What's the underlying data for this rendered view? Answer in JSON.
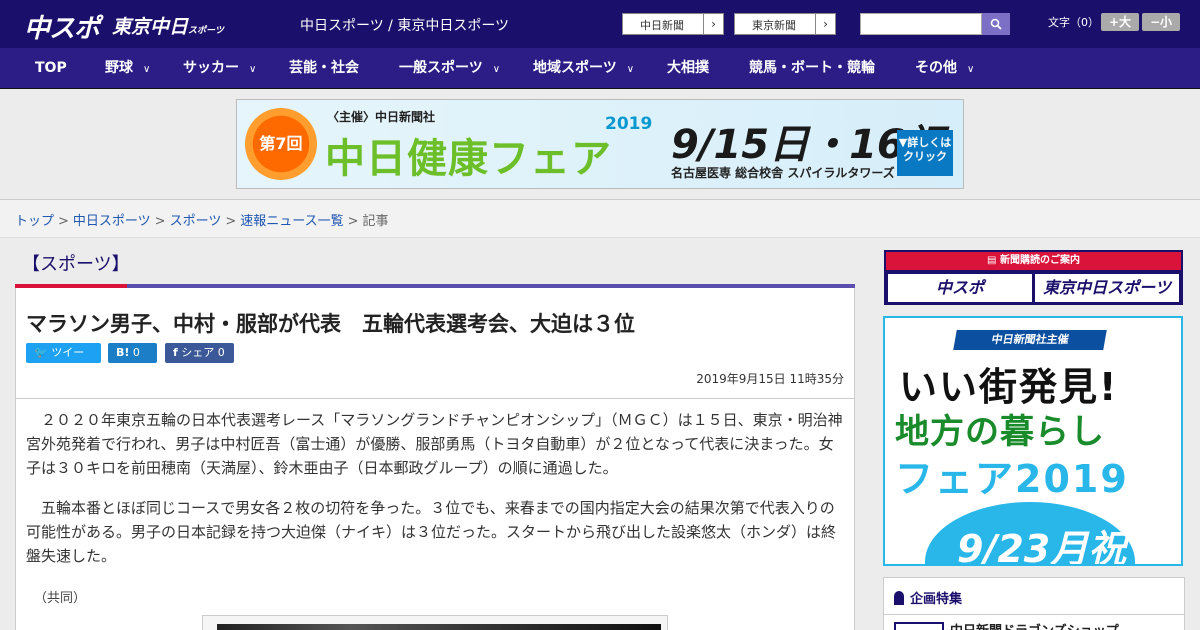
{
  "header": {
    "logo_chuspo": "中スポ",
    "logo_tokyo": "東京中日",
    "logo_tokyo_small": "スポーツ",
    "site_title": "中日スポーツ / 東京中日スポーツ",
    "pub_links": [
      {
        "label": "中日新聞"
      },
      {
        "label": "東京新聞"
      }
    ],
    "search": {
      "value": ""
    },
    "font_size": {
      "label": "文字（0）",
      "bigger": "+大",
      "smaller": "−小"
    }
  },
  "nav": {
    "items": [
      {
        "label": "TOP",
        "dropdown": false
      },
      {
        "label": "野球",
        "dropdown": true
      },
      {
        "label": "サッカー",
        "dropdown": true
      },
      {
        "label": "芸能・社会",
        "dropdown": false
      },
      {
        "label": "一般スポーツ",
        "dropdown": true
      },
      {
        "label": "地域スポーツ",
        "dropdown": true
      },
      {
        "label": "大相撲",
        "dropdown": false
      },
      {
        "label": "競馬・ボート・競輪",
        "dropdown": false
      },
      {
        "label": "その他",
        "dropdown": true
      }
    ]
  },
  "banner": {
    "edition": "第7回",
    "host": "〈主催〉中日新聞社",
    "title": "中日健康フェア",
    "year": "2019",
    "dates": "9/15日・16祝",
    "venue": "名古屋医専 総合校舎 スパイラルタワーズ",
    "cta": "▼詳しくはクリック"
  },
  "breadcrumb": {
    "items": [
      "トップ",
      "中日スポーツ",
      "スポーツ",
      "速報ニュース一覧"
    ],
    "current": "記事"
  },
  "article": {
    "category": "【スポーツ】",
    "headline": "マラソン男子、中村・服部が代表　五輪代表選考会、大迫は３位",
    "share": {
      "tweet": "ツイート",
      "hatena_count": "0",
      "facebook": "シェア",
      "facebook_count": "0"
    },
    "date": "2019年9月15日 11時35分",
    "paragraphs": [
      "　２０２０年東京五輪の日本代表選考レース「マラソングランドチャンピオンシップ」（ＭＧＣ）は１５日、東京・明治神宮外苑発着で行われ、男子は中村匠吾（富士通）が優勝、服部勇馬（トヨタ自動車）が２位となって代表に決まった。女子は３０キロを前田穂南（天満屋）、鈴木亜由子（日本郵政グループ）の順に通過した。",
      "　五輪本番とほぼ同じコースで男女各２枚の切符を争った。３位でも、来春までの国内指定大会の結果次第で代表入りの可能性がある。男子の日本記録を持つ大迫傑（ナイキ）は３位だった。スタートから飛び出した設楽悠太（ホンダ）は終盤失速した。"
    ],
    "credit": "（共同）"
  },
  "sidebar": {
    "subscribe": {
      "title": "新聞購読のご案内",
      "left": "中スポ",
      "right": "東京中日スポーツ"
    },
    "promo": {
      "host": "中日新聞社主催",
      "line1": "いい街発見!",
      "line2": "地方の暮らし",
      "line3": "フェア2019",
      "date": "9/23月祝"
    },
    "feature": {
      "title": "企画特集",
      "item": "中日新聞ドラゴンズショップ"
    }
  },
  "colors": {
    "header_bg": "#1a0f6b",
    "nav_bg": "#2b1c86",
    "accent_red": "#d9133a",
    "link_blue": "#1f57b2"
  }
}
